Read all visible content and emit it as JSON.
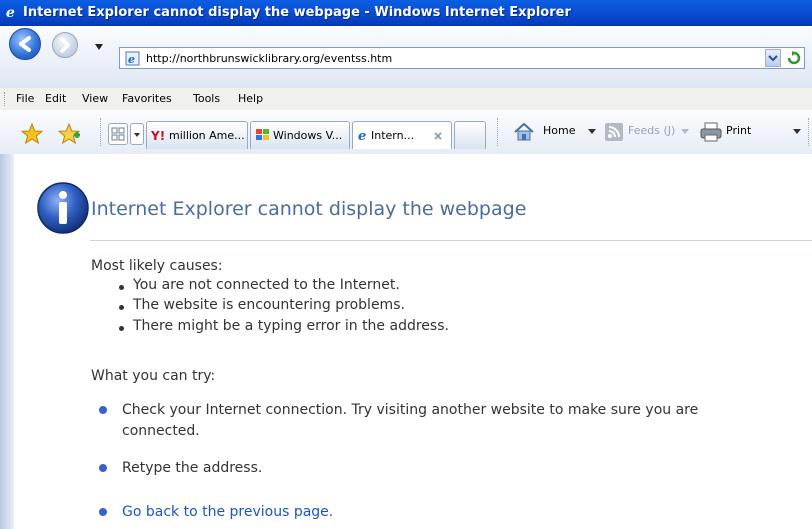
{
  "window": {
    "title": "Internet Explorer cannot display the webpage - Windows Internet Explorer"
  },
  "address_bar": {
    "url": "http://northbrunswicklibrary.org/eventss.htm"
  },
  "menu": {
    "items": [
      "File",
      "Edit",
      "View",
      "Favorites",
      "Tools",
      "Help"
    ]
  },
  "tabs": [
    {
      "label": "million Ame...",
      "icon": "yahoo-icon"
    },
    {
      "label": "Windows V...",
      "icon": "windows-flag-icon"
    },
    {
      "label": "Intern...",
      "icon": "ie-icon",
      "active": true
    }
  ],
  "command_bar": {
    "home_label": "Home",
    "feeds_label": "Feeds (J)",
    "print_label": "Print"
  },
  "error_page": {
    "heading": "Internet Explorer cannot display the webpage",
    "causes_title": "Most likely causes:",
    "causes": [
      "You are not connected to the Internet.",
      "The website is encountering problems.",
      "There might be a typing error in the address."
    ],
    "try_title": "What you can try:",
    "suggestions": [
      "Check your Internet connection. Try visiting another website to make sure you are",
      "connected.",
      "Retype the address.",
      "Go back to the previous page."
    ]
  },
  "colors": {
    "heading": "#4b6d9b",
    "link": "#1a55c9",
    "titlebar": "#0a4fd6"
  }
}
